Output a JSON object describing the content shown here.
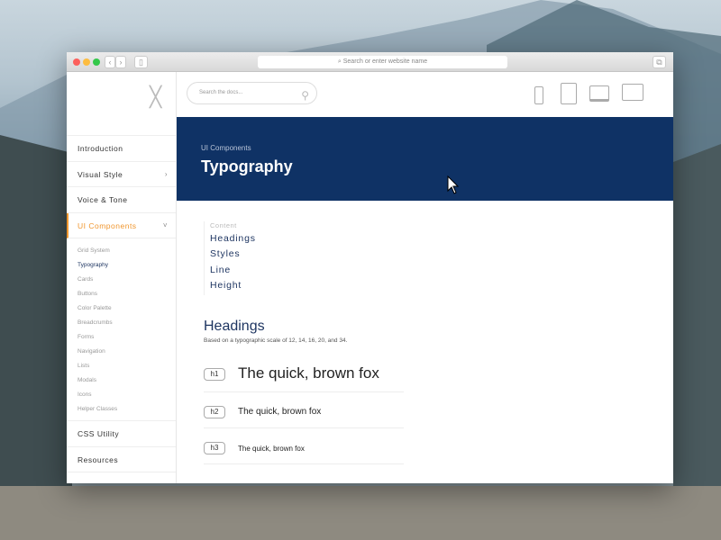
{
  "browser": {
    "url_placeholder": "Search or enter website name",
    "back": "‹",
    "forward": "›"
  },
  "header": {
    "search_placeholder": "Search the docs..."
  },
  "sidebar": {
    "items": [
      {
        "label": "Introduction"
      },
      {
        "label": "Visual Style",
        "chevron": "›"
      },
      {
        "label": "Voice & Tone"
      },
      {
        "label": "UI Components",
        "chevron": "˅"
      }
    ],
    "sub_items": [
      "Grid System",
      "Typography",
      "Cards",
      "Buttons",
      "Color Palette",
      "Breadcrumbs",
      "Forms",
      "Navigation",
      "Lists",
      "Modals",
      "Icons",
      "Helper Classes"
    ],
    "bottom_items": [
      "CSS Utility",
      "Resources"
    ]
  },
  "banner": {
    "breadcrumb": "UI Components",
    "title": "Typography"
  },
  "toc": {
    "label": "Content",
    "items": [
      "Headings",
      "Styles",
      "Line",
      "Height"
    ]
  },
  "section": {
    "title": "Headings",
    "description": "Based on a typographic scale of 12, 14, 16, 20, and 34."
  },
  "samples": [
    {
      "tag": "h1",
      "text": "The quick, brown fox"
    },
    {
      "tag": "h2",
      "text": "The quick, brown fox"
    },
    {
      "tag": "h3",
      "text": "The quick, brown fox"
    }
  ],
  "colors": {
    "accent": "#f0962e",
    "brand": "#0f3265"
  }
}
